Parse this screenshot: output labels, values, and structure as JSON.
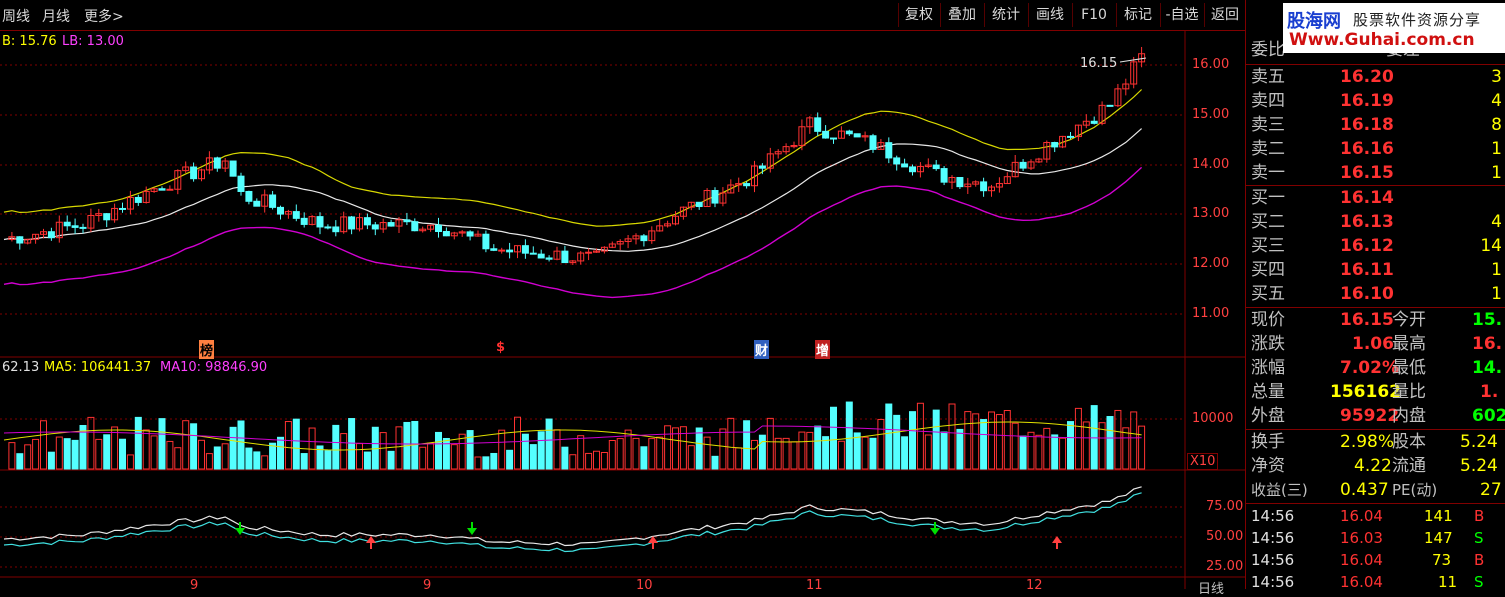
{
  "toolbar": {
    "left": [
      "周线",
      "月线",
      "更多>"
    ],
    "buttons": [
      "复权",
      "叠加",
      "统计",
      "画线",
      "F10",
      "标记",
      "-自选",
      "返回"
    ]
  },
  "main_legend": {
    "b": "B: 15.76",
    "lb": "LB: 13.00"
  },
  "vol_legend": {
    "vol": "62.13",
    "ma5": "MA5: 106441.37",
    "ma10": "MA10: 98846.90"
  },
  "price_axis": [
    "16.00",
    "15.00",
    "14.00",
    "13.00",
    "12.00",
    "11.00"
  ],
  "vol_axis": {
    "value": "10000",
    "unit": "X10"
  },
  "ind_axis": [
    "75.00",
    "50.00",
    "25.00"
  ],
  "x_axis": [
    "9",
    "9",
    "10",
    "11",
    "12"
  ],
  "period_label": "日线",
  "last_price_label": "16.15",
  "markers": [
    "榜",
    "$",
    "财",
    "增"
  ],
  "logo": {
    "brand": "股海网",
    "slogan": "股票软件资源分享",
    "url": "Www.Guhai.com.cn"
  },
  "quote": {
    "header": {
      "label": "委比",
      "value": "委差"
    },
    "sells": [
      {
        "label": "卖五",
        "price": "16.20",
        "vol": "3"
      },
      {
        "label": "卖四",
        "price": "16.19",
        "vol": "4"
      },
      {
        "label": "卖三",
        "price": "16.18",
        "vol": "8"
      },
      {
        "label": "卖二",
        "price": "16.16",
        "vol": "1"
      },
      {
        "label": "卖一",
        "price": "16.15",
        "vol": "1"
      }
    ],
    "buys": [
      {
        "label": "买一",
        "price": "16.14",
        "vol": ""
      },
      {
        "label": "买二",
        "price": "16.13",
        "vol": "4"
      },
      {
        "label": "买三",
        "price": "16.12",
        "vol": "14"
      },
      {
        "label": "买四",
        "price": "16.11",
        "vol": "1"
      },
      {
        "label": "买五",
        "price": "16.10",
        "vol": "1"
      }
    ],
    "stats": [
      {
        "l1": "现价",
        "v1": "16.15",
        "l2": "今开",
        "v2": "15."
      },
      {
        "l1": "涨跌",
        "v1": "1.06",
        "l2": "最高",
        "v2": "16."
      },
      {
        "l1": "涨幅",
        "v1": "7.02%",
        "l2": "最低",
        "v2": "14."
      },
      {
        "l1": "总量",
        "v1": "156162",
        "l2": "量比",
        "v2": "1."
      },
      {
        "l1": "外盘",
        "v1": "95922",
        "l2": "内盘",
        "v2": "602"
      }
    ],
    "stats2": [
      {
        "l1": "换手",
        "v1": "2.98%",
        "l2": "股本",
        "v2": "5.24"
      },
      {
        "l1": "净资",
        "v1": "4.22",
        "l2": "流通",
        "v2": "5.24"
      },
      {
        "l1": "收益(三)",
        "v1": "0.437",
        "l2": "PE(动)",
        "v2": "27"
      }
    ],
    "ticks": [
      {
        "time": "14:56",
        "price": "16.04",
        "vol": "141",
        "side": "B"
      },
      {
        "time": "14:56",
        "price": "16.03",
        "vol": "147",
        "side": "S"
      },
      {
        "time": "14:56",
        "price": "16.04",
        "vol": "73",
        "side": "B"
      },
      {
        "time": "14:56",
        "price": "16.04",
        "vol": "11",
        "side": "S"
      }
    ]
  },
  "colors": {
    "up": "#ff3232",
    "down": "#54ffff",
    "ma_yellow": "#ffff00",
    "ma_purple": "#ff00ff",
    "grid": "#800000"
  }
}
